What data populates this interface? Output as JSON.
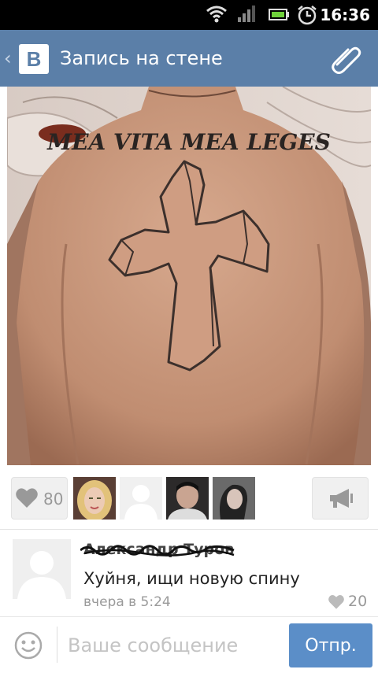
{
  "status_bar": {
    "time": "16:36",
    "icons": [
      "wifi-icon",
      "signal-icon",
      "battery-icon",
      "alarm-icon"
    ]
  },
  "header": {
    "logo_letter": "B",
    "title": "Запись на стене",
    "attach_icon": "paperclip-icon"
  },
  "post": {
    "image_tattoo_text": "MEA VITA MEA LEGES"
  },
  "likes": {
    "count": "80",
    "liker_avatars": [
      "avatar-blonde-woman",
      "avatar-placeholder",
      "avatar-man",
      "avatar-woman-dark"
    ],
    "share_icon": "megaphone-icon"
  },
  "comment": {
    "author": "Александр Туров",
    "text": "Хуйня, ищи новую спину",
    "time": "вчера в 5:24",
    "likes": "20"
  },
  "composer": {
    "placeholder": "Ваше сообщение",
    "send_label": "Отпр."
  },
  "colors": {
    "header_bg": "#5b7fa8",
    "send_button": "#5b8ec8",
    "status_bar": "#000000"
  }
}
